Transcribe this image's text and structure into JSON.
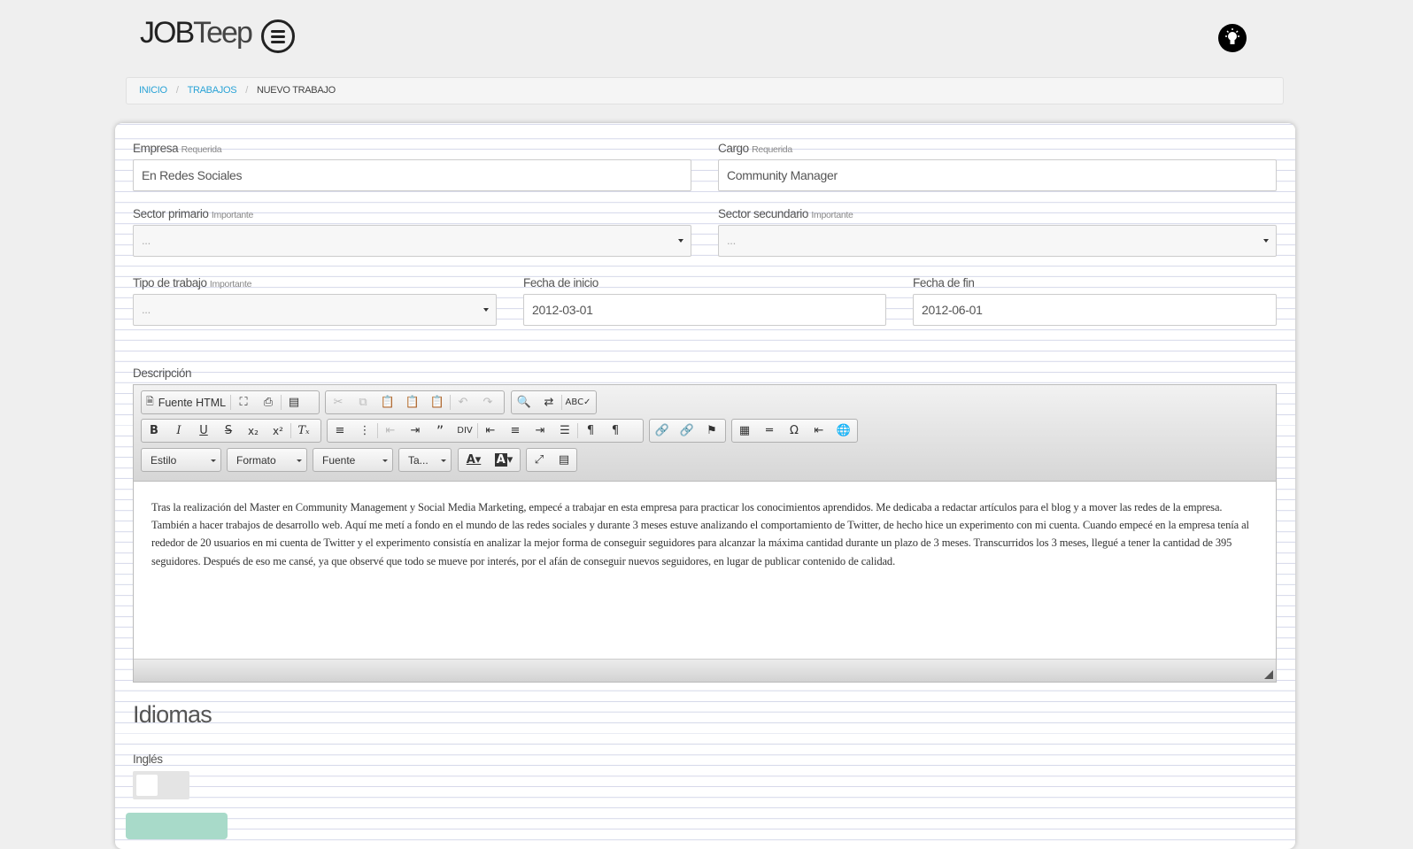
{
  "header": {
    "logo_bold": "JOB",
    "logo_light": "Teep",
    "menu_icon": "hamburger-icon",
    "bulb_icon": "lightbulb-icon"
  },
  "breadcrumb": {
    "items": [
      "INICIO",
      "TRABAJOS"
    ],
    "current": "NUEVO TRABAJO"
  },
  "form": {
    "empresa": {
      "label": "Empresa",
      "hint": "Requerida",
      "value": "En Redes Sociales"
    },
    "cargo": {
      "label": "Cargo",
      "hint": "Requerida",
      "value": "Community Manager"
    },
    "sector_primario": {
      "label": "Sector primario",
      "hint": "Importante",
      "value": "..."
    },
    "sector_secundario": {
      "label": "Sector secundario",
      "hint": "Importante",
      "value": "..."
    },
    "tipo_trabajo": {
      "label": "Tipo de trabajo",
      "hint": "Importante",
      "value": "..."
    },
    "fecha_inicio": {
      "label": "Fecha de inicio",
      "value": "2012-03-01"
    },
    "fecha_fin": {
      "label": "Fecha de fin",
      "value": "2012-06-01"
    },
    "descripcion": {
      "label": "Descripción"
    }
  },
  "editor": {
    "source_label": "Fuente HTML",
    "combos": {
      "estilo": "Estilo",
      "formato": "Formato",
      "fuente": "Fuente",
      "tamano": "Ta..."
    },
    "content": "Tras la realización del Master en Community Management y Social Media Marketing, empecé a trabajar en esta empresa para practicar los conocimientos aprendidos. Me dedicaba a redactar artículos para el blog y a mover las redes de la empresa. También a hacer trabajos de desarrollo web. Aquí me metí a fondo en el mundo de las redes sociales y durante 3 meses estuve analizando el comportamiento de Twitter, de hecho hice un experimento con mi cuenta. Cuando empecé en la empresa tenía al rededor de 20 usuarios en mi cuenta de Twitter y el experimento consistía en analizar la mejor forma de conseguir seguidores para alcanzar la máxima cantidad durante un plazo de 3 meses. Transcurridos los 3 meses, llegué a tener la cantidad de 395 seguidores. Después de eso me cansé, ya que observé que todo se mueve por interés, por el afán de conseguir nuevos seguidores, en lugar de publicar contenido de calidad."
  },
  "idiomas": {
    "title": "Idiomas",
    "ingles_label": "Inglés",
    "ingles_on": false
  }
}
